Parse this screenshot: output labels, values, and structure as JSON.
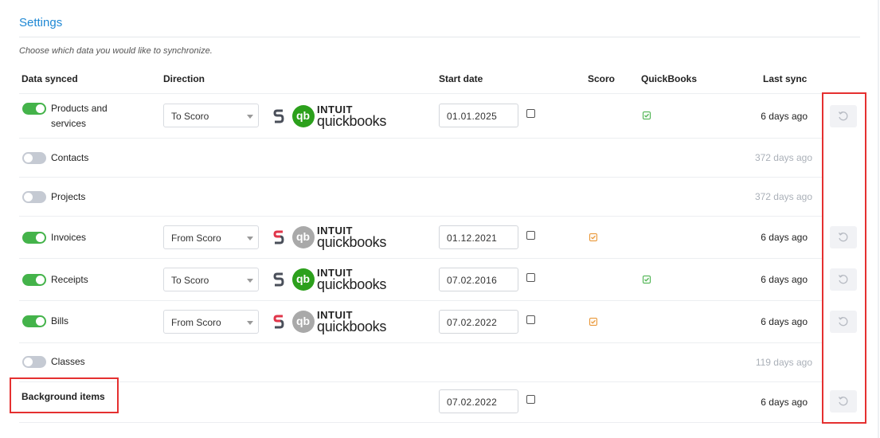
{
  "settings": {
    "title": "Settings",
    "subtitle": "Choose which data you would like to synchronize."
  },
  "columns": {
    "data_synced": "Data synced",
    "direction": "Direction",
    "start_date": "Start date",
    "scoro": "Scoro",
    "quickbooks": "QuickBooks",
    "last_sync": "Last sync"
  },
  "logo": {
    "intuit": "INTUIT",
    "quickbooks": "quickbooks",
    "qb_mark": "qb",
    "scoro_mark": "S"
  },
  "rows": [
    {
      "label_line1": "Products and",
      "label_line2": "services",
      "enabled": true,
      "direction": "To Scoro",
      "start_date": "01.01.2025",
      "checked_side": "quickbooks",
      "last_sync": "6 days ago"
    },
    {
      "label": "Contacts",
      "enabled": false,
      "last_sync": "372 days ago"
    },
    {
      "label": "Projects",
      "enabled": false,
      "last_sync": "372 days ago"
    },
    {
      "label": "Invoices",
      "enabled": true,
      "direction": "From Scoro",
      "start_date": "01.12.2021",
      "checked_side": "scoro",
      "last_sync": "6 days ago"
    },
    {
      "label": "Receipts",
      "enabled": true,
      "direction": "To Scoro",
      "start_date": "07.02.2016",
      "checked_side": "quickbooks",
      "last_sync": "6 days ago"
    },
    {
      "label": "Bills",
      "enabled": true,
      "direction": "From Scoro",
      "start_date": "07.02.2022",
      "checked_side": "scoro",
      "last_sync": "6 days ago"
    },
    {
      "label": "Classes",
      "enabled": false,
      "last_sync": "119 days ago"
    }
  ],
  "background_items": {
    "label": "Background items",
    "start_date": "07.02.2022",
    "last_sync": "6 days ago"
  },
  "colors": {
    "accent": "#1f88d4",
    "toggle_on": "#44b34a",
    "toggle_off": "#c5cad3",
    "qb_green": "#2ca01c",
    "qb_gray": "#a9a9a9",
    "check_green": "#46b04a",
    "check_orange": "#e89432",
    "highlight": "#e53030"
  },
  "icons": {
    "reset": "reset-sync-icon",
    "dropdown": "chevron-down-icon"
  }
}
